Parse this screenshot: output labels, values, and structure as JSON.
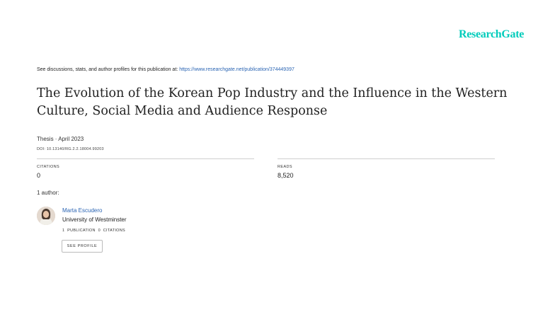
{
  "logo": {
    "text": "ResearchGate"
  },
  "header": {
    "see_text": "See discussions, stats, and author profiles for this publication at:",
    "link": "https://www.researchgate.net/publication/374449397"
  },
  "publication": {
    "title": "The Evolution of the Korean Pop Industry and the Influence in the Western Culture, Social Media and Audience Response",
    "type_date": "Thesis · April 2023",
    "doi": "DOI: 10.13140/RG.2.2.18004.99203"
  },
  "stats": {
    "citations_label": "CITATIONS",
    "citations_value": "0",
    "reads_label": "READS",
    "reads_value": "8,520"
  },
  "authors": {
    "header": "1 author:",
    "list": [
      {
        "name": "Marta Escudero",
        "affiliation": "University of Westminster",
        "stats": "1 PUBLICATION   0 CITATIONS",
        "button": "SEE PROFILE"
      }
    ]
  },
  "colors": {
    "brand": "#00ccbb",
    "link": "#2a64b3"
  }
}
